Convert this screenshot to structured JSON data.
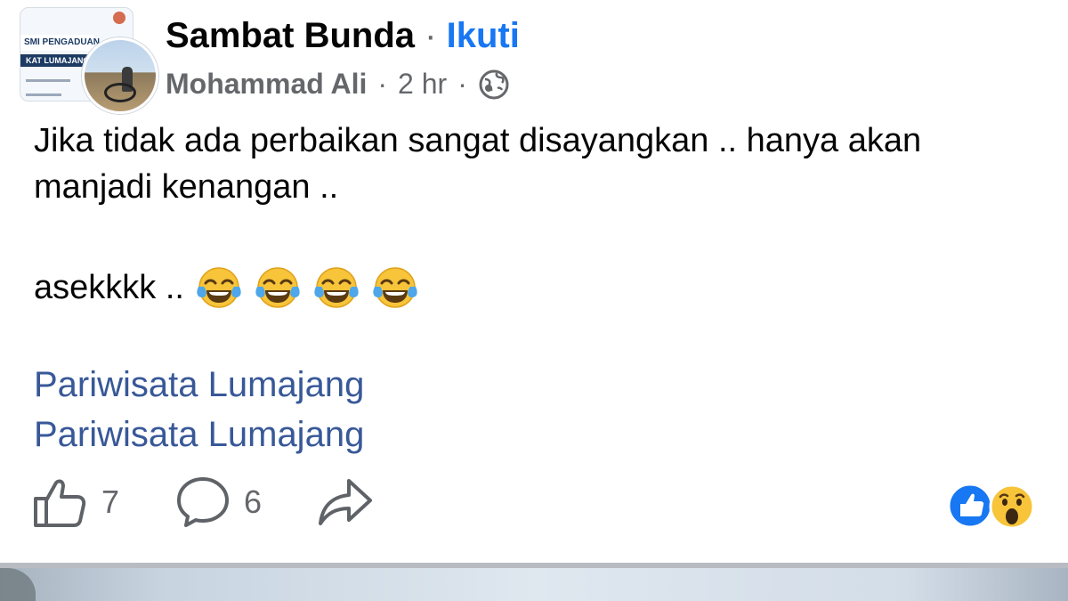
{
  "post": {
    "group_name": "Sambat Bunda",
    "separator": "·",
    "follow_label": "Ikuti",
    "author": "Mohammad Ali",
    "time": "2 hr",
    "privacy_icon": "globe-icon",
    "group_avatar_text": {
      "line1": "SMI PENGADUAN",
      "line2": "KAT LUMAJANG"
    },
    "body_line1": "Jika tidak ada perbaikan sangat disayangkan .. hanya akan manjadi kenangan ..",
    "body_line2": "asekkkk ..",
    "emoji_icons": [
      "face-with-tears-of-joy-icon",
      "face-with-tears-of-joy-icon",
      "face-with-tears-of-joy-icon",
      "face-with-tears-of-joy-icon"
    ],
    "links": [
      "Pariwisata Lumajang",
      "Pariwisata Lumajang"
    ]
  },
  "actions": {
    "like_count": "7",
    "comment_count": "6",
    "share_icon": "share-icon"
  },
  "reactions": [
    "like-reaction-icon",
    "wow-reaction-icon"
  ],
  "colors": {
    "link": "#385898",
    "follow": "#1877f2",
    "meta": "#65676b",
    "like_blue": "#1877f2"
  }
}
